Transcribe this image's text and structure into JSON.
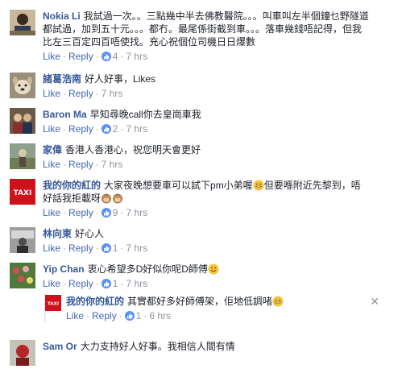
{
  "actions": {
    "like": "Like",
    "reply": "Reply",
    "sep": "·"
  },
  "comments": [
    {
      "author": "Nokia Li",
      "text": "我試過一次。。三點幾中半去佛教醫院。。。叫車叫左半個鐘乜野隧道都試過，加到五十元。。。都冇。最尾係街截到車。。。落車幾錢唔記得，但我比左三百定四百唔使找。充心祝個位司機日日爆數",
      "likes": "4",
      "time": "7 hrs",
      "avatar_icon": "person-photo-icon"
    },
    {
      "author": "諸葛浩南",
      "text": "好人好事，Likes",
      "likes": "",
      "time": "7 hrs",
      "avatar_icon": "dog-photo-icon"
    },
    {
      "author": "Baron Ma",
      "text": "早知尋晚call你去皇崗車我",
      "likes": "2",
      "time": "7 hrs",
      "avatar_icon": "group-photo-icon"
    },
    {
      "author": "家偉",
      "text": "香港人香港心，祝您明天會更好",
      "likes": "",
      "time": "7 hrs",
      "avatar_icon": "landscape-photo-icon"
    },
    {
      "author": "我的你的紅的",
      "text": "大家夜晚想要車可以試下pm小弟喔",
      "text2": "但要喺附近先黎到，唔好話我拒載呀",
      "likes": "9",
      "time": "7 hrs",
      "avatar_icon": "taxi-logo-icon"
    },
    {
      "author": "林向東",
      "text": "好心人",
      "likes": "1",
      "time": "7 hrs",
      "avatar_icon": "bw-photo-icon"
    },
    {
      "author": "Yip Chan",
      "text": "衷心希望多D好似你呢D師傅",
      "likes": "1",
      "time": "7 hrs",
      "avatar_icon": "flowers-photo-icon"
    },
    {
      "author": "我的你的紅的",
      "text": "其實都好多好師傅架，佢地低調啫",
      "likes": "1",
      "time": "6 hrs",
      "avatar_icon": "taxi-logo-icon",
      "close": "✕"
    },
    {
      "author": "Sam Or",
      "text": "大力支持好人好事。我相信人間有情",
      "likes": "",
      "time": "",
      "avatar_icon": "red-photo-icon"
    }
  ]
}
